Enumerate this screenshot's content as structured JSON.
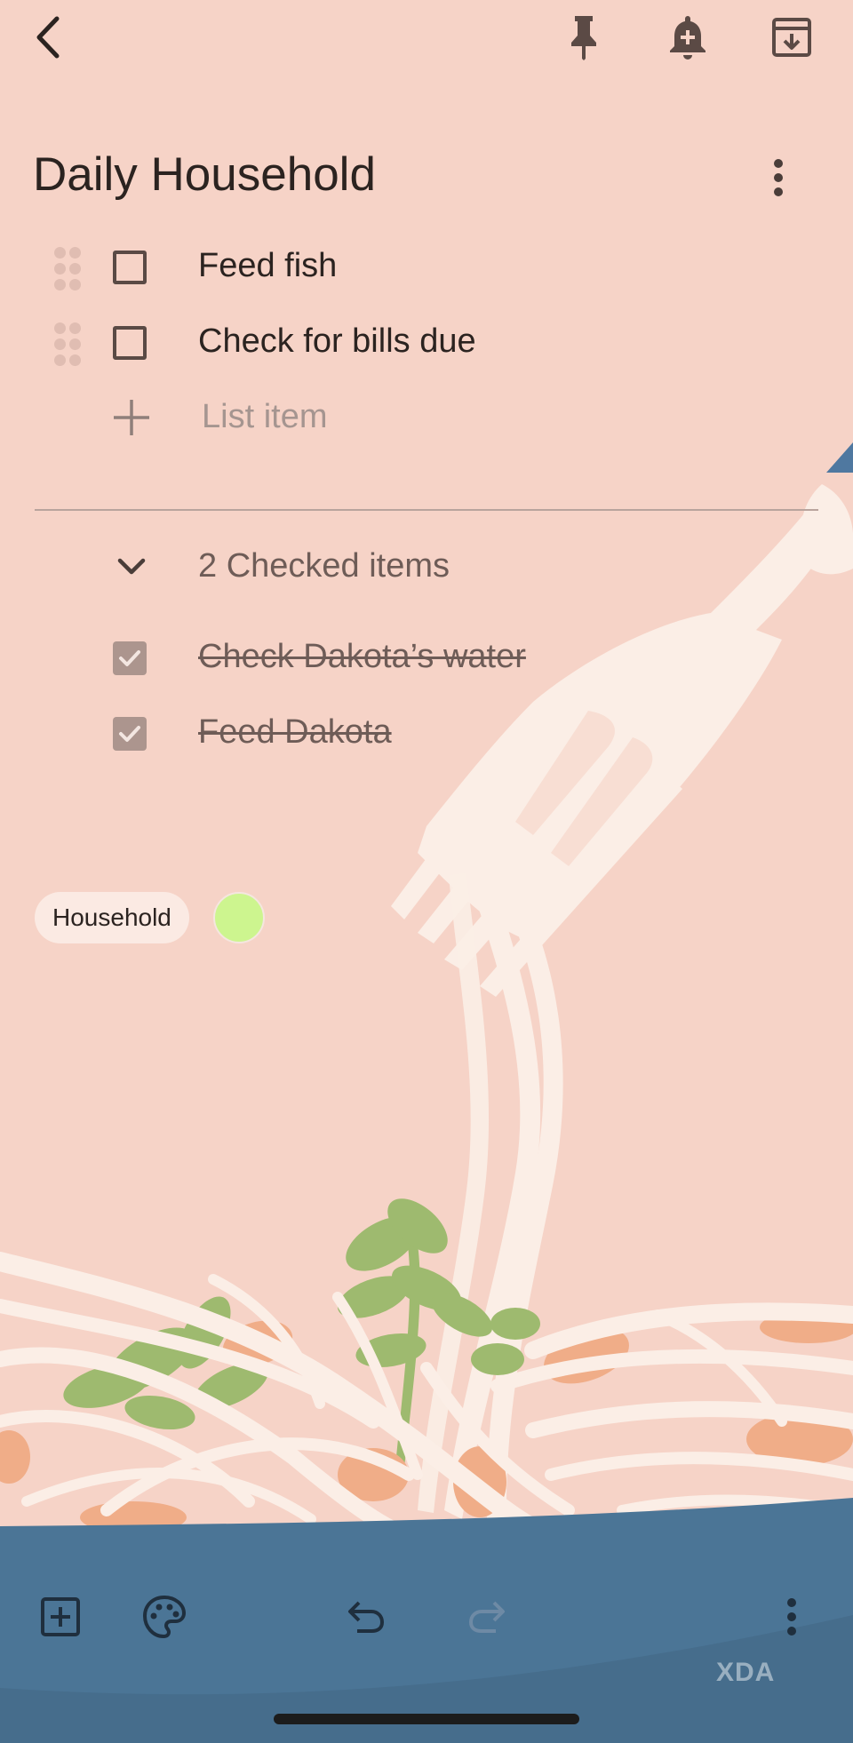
{
  "note": {
    "title": "Daily Household",
    "unchecked_items": [
      {
        "text": "Feed fish",
        "checked": false
      },
      {
        "text": "Check for bills due",
        "checked": false
      }
    ],
    "add_item_placeholder": "List item",
    "checked_section_label": "2 Checked items",
    "checked_items": [
      {
        "text": "Check Dakota’s water",
        "checked": true
      },
      {
        "text": "Feed Dakota",
        "checked": true
      }
    ],
    "label_chip": "Household",
    "note_color": "#cdf58f"
  },
  "top_bar": {
    "icons": [
      "back-arrow-icon",
      "pin-icon",
      "reminder-bell-icon",
      "archive-icon"
    ]
  },
  "bottom_bar": {
    "icons": [
      "add-box-icon",
      "palette-icon",
      "undo-icon",
      "redo-icon",
      "more-vertical-icon"
    ]
  },
  "watermark": "XDA",
  "colors": {
    "background": "#f6d3c7",
    "footer": "#4b7596",
    "text": "#2b2320"
  }
}
